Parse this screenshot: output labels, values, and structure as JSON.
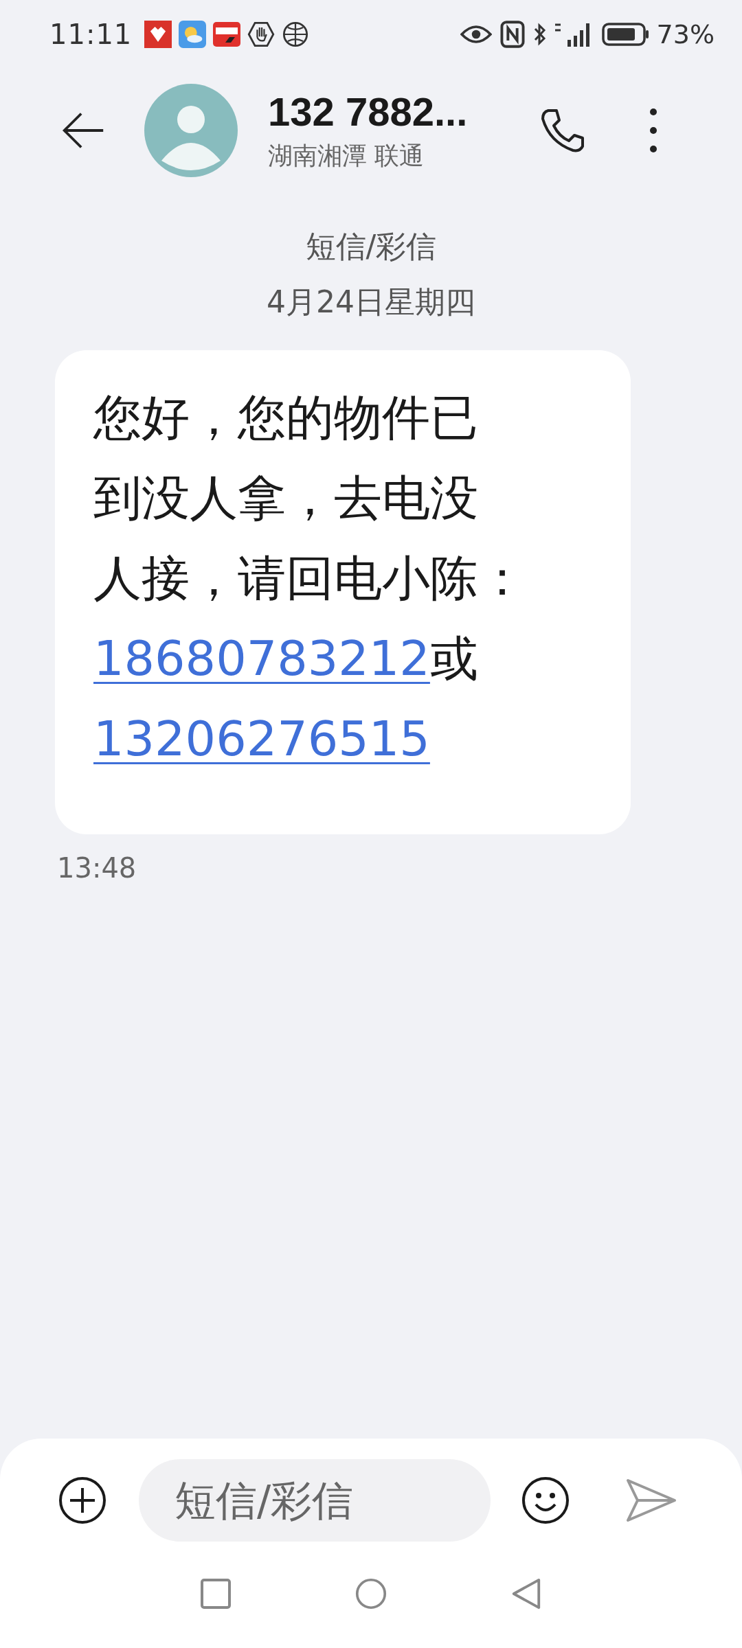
{
  "status_bar": {
    "time": "11:11",
    "battery": "73%"
  },
  "header": {
    "title": "132 7882...",
    "subtitle": "湖南湘潭 联通"
  },
  "conversation": {
    "label": "短信/彩信",
    "date": "4月24日星期四"
  },
  "message": {
    "lines": [
      [
        {
          "kind": "text",
          "text": "您好，您的物件已"
        }
      ],
      [
        {
          "kind": "text",
          "text": "到没人拿，去电没"
        }
      ],
      [
        {
          "kind": "text",
          "text": "人接，请回电小陈："
        }
      ],
      [
        {
          "kind": "link",
          "text": "18680783212"
        },
        {
          "kind": "text",
          "text": "或"
        }
      ],
      [
        {
          "kind": "link",
          "text": "13206276515"
        }
      ]
    ],
    "time": "13:48"
  },
  "composer": {
    "placeholder": "短信/彩信"
  }
}
